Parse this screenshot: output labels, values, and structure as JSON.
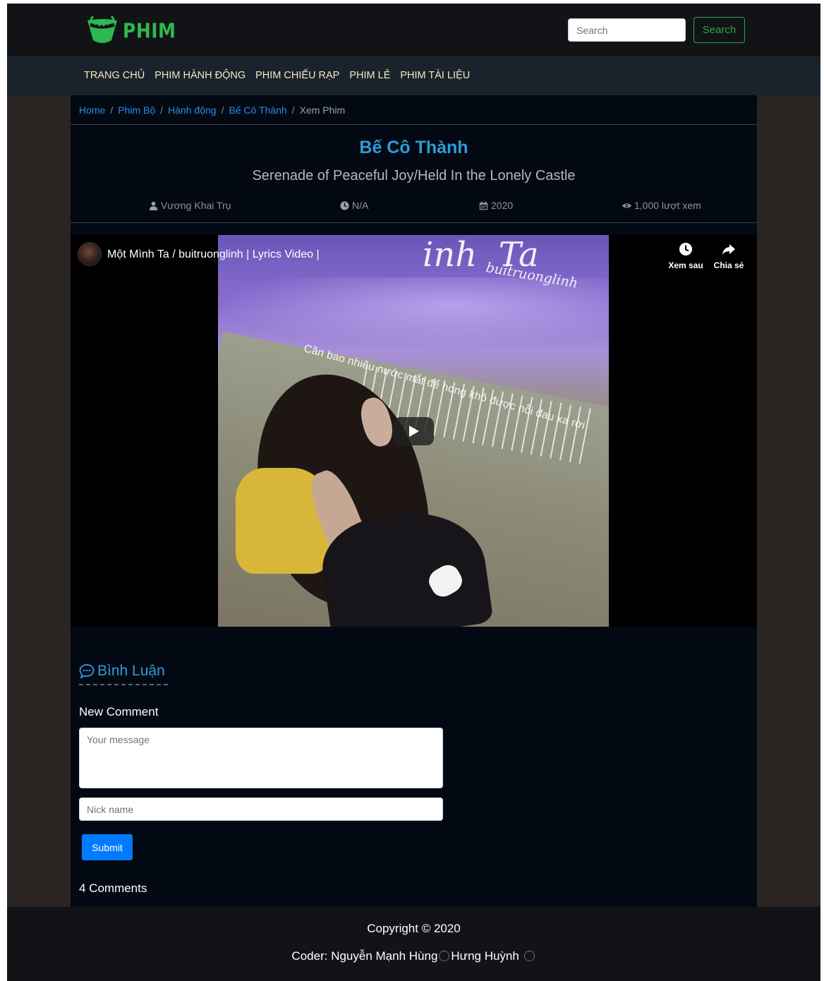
{
  "header": {
    "logo_text": "PHIM",
    "logo_color": "#2eb84f",
    "search_placeholder": "Search",
    "search_button": "Search"
  },
  "nav": {
    "items": [
      {
        "label": "TRANG CHỦ"
      },
      {
        "label": "PHIM HÀNH ĐỘNG"
      },
      {
        "label": "PHIM CHIẾU RẠP"
      },
      {
        "label": "PHIM LẺ"
      },
      {
        "label": "PHIM TÀI LIỆU"
      }
    ]
  },
  "breadcrumb": {
    "items": [
      "Home",
      "Phim Bộ",
      "Hành động",
      "Bế Cô Thành"
    ],
    "active": "Xem Phim",
    "separator": "/"
  },
  "movie": {
    "title": "Bế Cô Thành",
    "subtitle": "Serenade of Peaceful Joy/Held In the Lonely Castle",
    "director": "Vương Khai Trụ",
    "duration": "N/A",
    "year": "2020",
    "views": "1,000 lượt xem"
  },
  "video": {
    "title": "Một Mình Ta / buitruonglinh | Lyrics Video |",
    "watch_later": "Xem sau",
    "share": "Chia sẻ",
    "overlay_title": "Ta",
    "overlay_title_prefix": "inh",
    "overlay_artist": "buitruonglinh",
    "overlay_lyric": "Cần bao nhiêu nước mắt để hong khô được nỗi đau xa rời"
  },
  "comments": {
    "heading": "Bình Luận",
    "new_comment_label": "New Comment",
    "message_placeholder": "Your message",
    "nick_placeholder": "Nick name",
    "submit_label": "Submit",
    "count_text": "4 Comments"
  },
  "footer": {
    "copyright": "Copyright © 2020",
    "coder_prefix": "Coder:",
    "coder_1": "Nguyễn Mạnh Hùng",
    "coder_2": "Hưng Huỳnh"
  },
  "colors": {
    "accent_blue": "#2f9bdb",
    "link_blue": "#2a8ce8",
    "nav_text": "#f4e7bf",
    "primary_button": "#007bff",
    "success_green": "#28a745"
  }
}
